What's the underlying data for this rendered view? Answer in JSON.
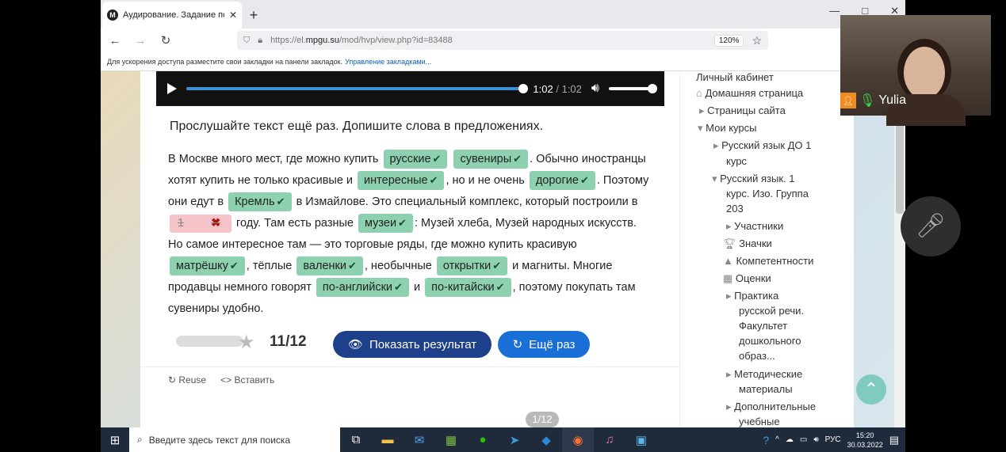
{
  "browser": {
    "tab_title": "Аудирование. Задание по тек",
    "tab_favicon": "M",
    "url_prefix": "https://el.",
    "url_domain": "mpgu.su",
    "url_path": "/mod/hvp/view.php?id=83488",
    "zoom": "120%",
    "bookmarks_hint": "Для ускорения доступа разместите свои закладки на панели закладок.",
    "bookmarks_link": "Управление закладками..."
  },
  "player": {
    "current_time": "1:02",
    "separator": "/",
    "total_time": "1:02"
  },
  "task": {
    "instruction": "Прослушайте текст ещё раз. Допишите слова в предложениях.",
    "p1": "В Москве много мест, где можно купить",
    "a1": "русские",
    "a2": "сувениры",
    "p2": ". Обычно иностранцы хотят купить не только красивые и",
    "a3": "интересные",
    "p3": ", но и не очень",
    "a4": "дорогие",
    "p4": ". Поэтому они едут в",
    "a5": "Кремль",
    "p5": "в Измайлове. Это специальный комплекс, который построили в",
    "a6_wrong": "1",
    "p6": "году. Там есть разные",
    "a7": "музеи",
    "p7": ": Музей хлеба, Музей народных искусств. Но самое интересное там — это торговые ряды, где можно купить красивую",
    "a8": "матрёшку",
    "p8": ", тёплые",
    "a9": "валенки",
    "p9": ", необычные",
    "a10": "открытки",
    "p10": "и магниты. Многие продавцы немного говорят",
    "a11": "по-английски",
    "p11": "и",
    "a12": "по-китайски",
    "p12": ", поэтому покупать там сувениры удобно."
  },
  "score": {
    "earned": "11",
    "slash": "/",
    "total": "12",
    "show_result_label": "Показать результат",
    "retry_label": "Ещё раз"
  },
  "footer": {
    "reuse_label": "Reuse",
    "embed_label": "Вставить"
  },
  "pager": "1/12",
  "sidebar": {
    "items": [
      "Личный кабинет",
      "Домашняя страница",
      "Страницы сайта",
      "Мои курсы",
      "Русский язык ДО 1",
      "курс",
      "Русский язык. 1",
      "курс. Изо. Группа",
      "203",
      "Участники",
      "Значки",
      "Компетентности",
      "Оценки",
      "Практика",
      "русской речи.",
      "Факультет",
      "дошкольного",
      "образ...",
      "Методические",
      "материалы",
      "Дополнительные",
      "учебные"
    ]
  },
  "video": {
    "participant_name": "Yulia"
  },
  "taskbar": {
    "search_placeholder": "Введите здесь текст для поиска",
    "lang": "РУС",
    "time": "15:20",
    "date": "30.03.2022"
  }
}
